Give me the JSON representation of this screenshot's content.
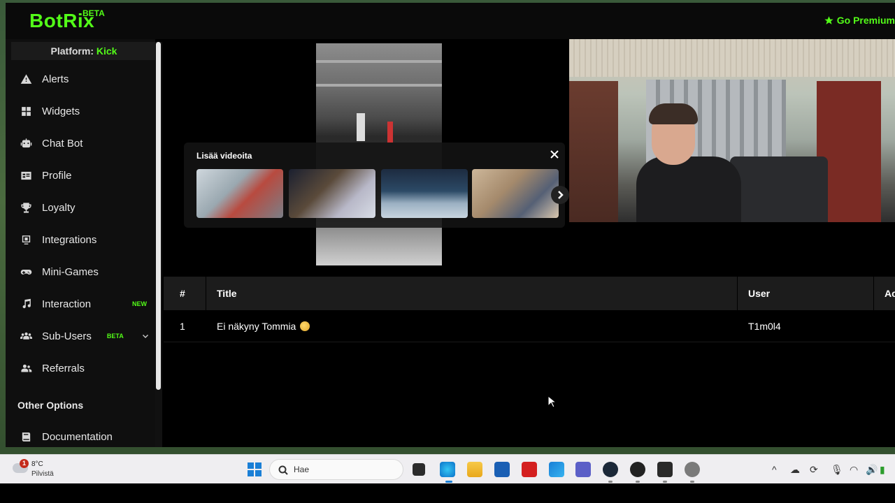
{
  "header": {
    "brand": "BotRix",
    "brand_badge": "BETA",
    "premium_label": "Go Premium"
  },
  "sidebar": {
    "platform_label": "Platform:",
    "platform_value": "Kick",
    "items": [
      {
        "label": "Alerts",
        "icon": "warning-icon"
      },
      {
        "label": "Widgets",
        "icon": "grid-icon"
      },
      {
        "label": "Chat Bot",
        "icon": "robot-icon"
      },
      {
        "label": "Profile",
        "icon": "id-card-icon"
      },
      {
        "label": "Loyalty",
        "icon": "trophy-icon"
      },
      {
        "label": "Integrations",
        "icon": "integration-icon"
      },
      {
        "label": "Mini-Games",
        "icon": "gamepad-icon"
      },
      {
        "label": "Interaction",
        "icon": "music-icon",
        "badge": "NEW"
      },
      {
        "label": "Sub-Users",
        "icon": "users-icon",
        "badge": "BETA"
      },
      {
        "label": "Referrals",
        "icon": "user-group-icon"
      }
    ],
    "section_title": "Other Options",
    "doc_item": {
      "label": "Documentation",
      "icon": "book-icon"
    }
  },
  "video": {
    "overlay_title": "Lisää videoita"
  },
  "table": {
    "headers": [
      "#",
      "Title",
      "User",
      "Ac"
    ],
    "rows": [
      {
        "num": "1",
        "title": "Ei näkyny Tommia",
        "user": "T1m0l4"
      }
    ]
  },
  "taskbar": {
    "notification_count": "1",
    "temperature": "8°C",
    "condition": "Pilvistä",
    "search_placeholder": "Hae"
  }
}
